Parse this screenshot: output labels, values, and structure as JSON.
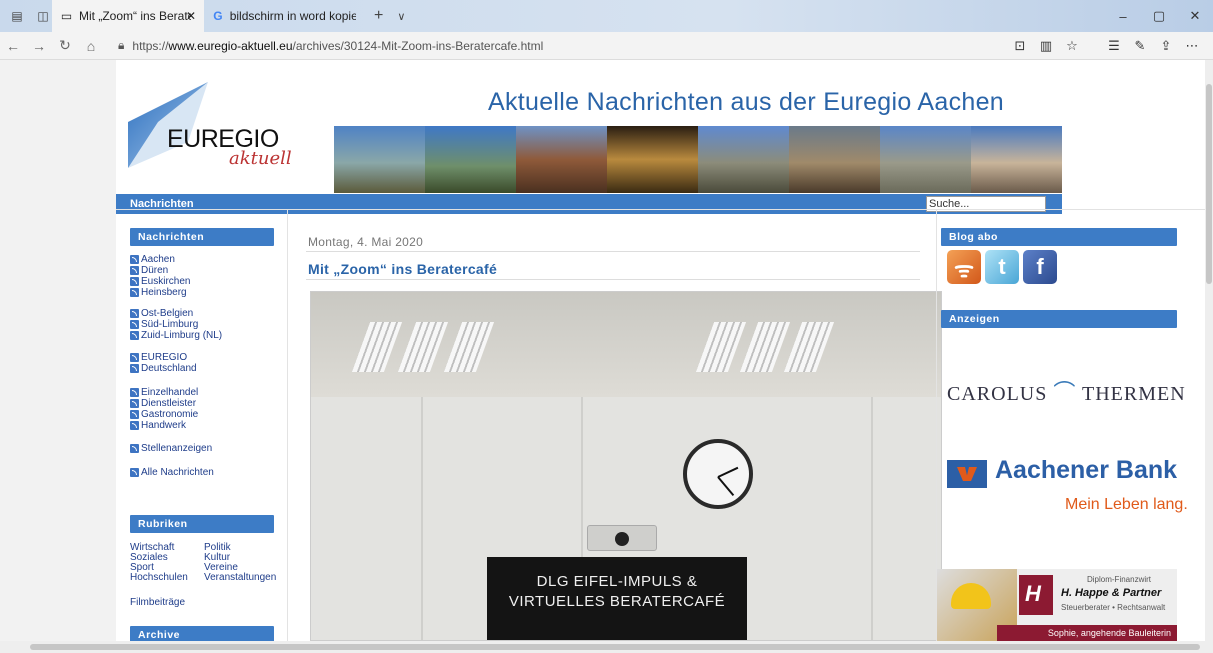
{
  "browser": {
    "tabs": [
      {
        "label": "Mit „Zoom“ ins Beraterc",
        "active": true
      },
      {
        "label": "bildschirm in word kopieren",
        "active": false
      }
    ],
    "url_prefix": "https://",
    "url_domain": "www.euregio-aktuell.eu",
    "url_path": "/archives/30124-Mit-Zoom-ins-Beratercafe.html"
  },
  "site": {
    "logo_text": "EUREGIO",
    "logo_script": "aktuell",
    "title": "Aktuelle Nachrichten aus der Euregio Aachen",
    "menu_label": "Nachrichten",
    "search_value": "Suche..."
  },
  "sidebar_left": {
    "nachrichten_head": "Nachrichten",
    "groups": [
      [
        "Aachen",
        "Düren",
        "Euskirchen",
        "Heinsberg"
      ],
      [
        "Ost-Belgien",
        "Süd-Limburg",
        "Zuid-Limburg (NL)"
      ],
      [
        "EUREGIO",
        "Deutschland"
      ],
      [
        "Einzelhandel",
        "Dienstleister",
        "Gastronomie",
        "Handwerk"
      ],
      [
        "Stellenanzeigen"
      ],
      [
        "Alle Nachrichten"
      ]
    ],
    "rubriken_head": "Rubriken",
    "rubriken_col1": [
      "Wirtschaft",
      "Soziales",
      "Sport",
      "Hochschulen"
    ],
    "rubriken_col2": [
      "Politik",
      "Kultur",
      "Vereine",
      "Veranstaltungen"
    ],
    "filmbeitraege": "Filmbeiträge",
    "archive_head": "Archive"
  },
  "post": {
    "date": "Montag, 4. Mai 2020",
    "title": "Mit „Zoom“ ins Beratercafé",
    "screen_line1": "DLG EIFEL-IMPULS &",
    "screen_line2": "VIRTUELLES BERATERCAFÉ"
  },
  "sidebar_right": {
    "blog_head": "Blog abo",
    "anzeigen_head": "Anzeigen",
    "carolus_left": "CAROLUS",
    "carolus_right": "THERMEN",
    "bank_name": "Aachener Bank",
    "bank_slogan": "Mein Leben lang.",
    "happe_line1": "Diplom-Finanzwirt",
    "happe_line2": "H. Happe & Partner",
    "happe_line3": "Steuerberater • Rechtsanwalt",
    "happe_caption": "Sophie, angehende Bauleiterin"
  },
  "colors": {
    "accent": "#3d7cc6",
    "title_blue": "#2a64a8",
    "link": "#1f3d8a"
  }
}
